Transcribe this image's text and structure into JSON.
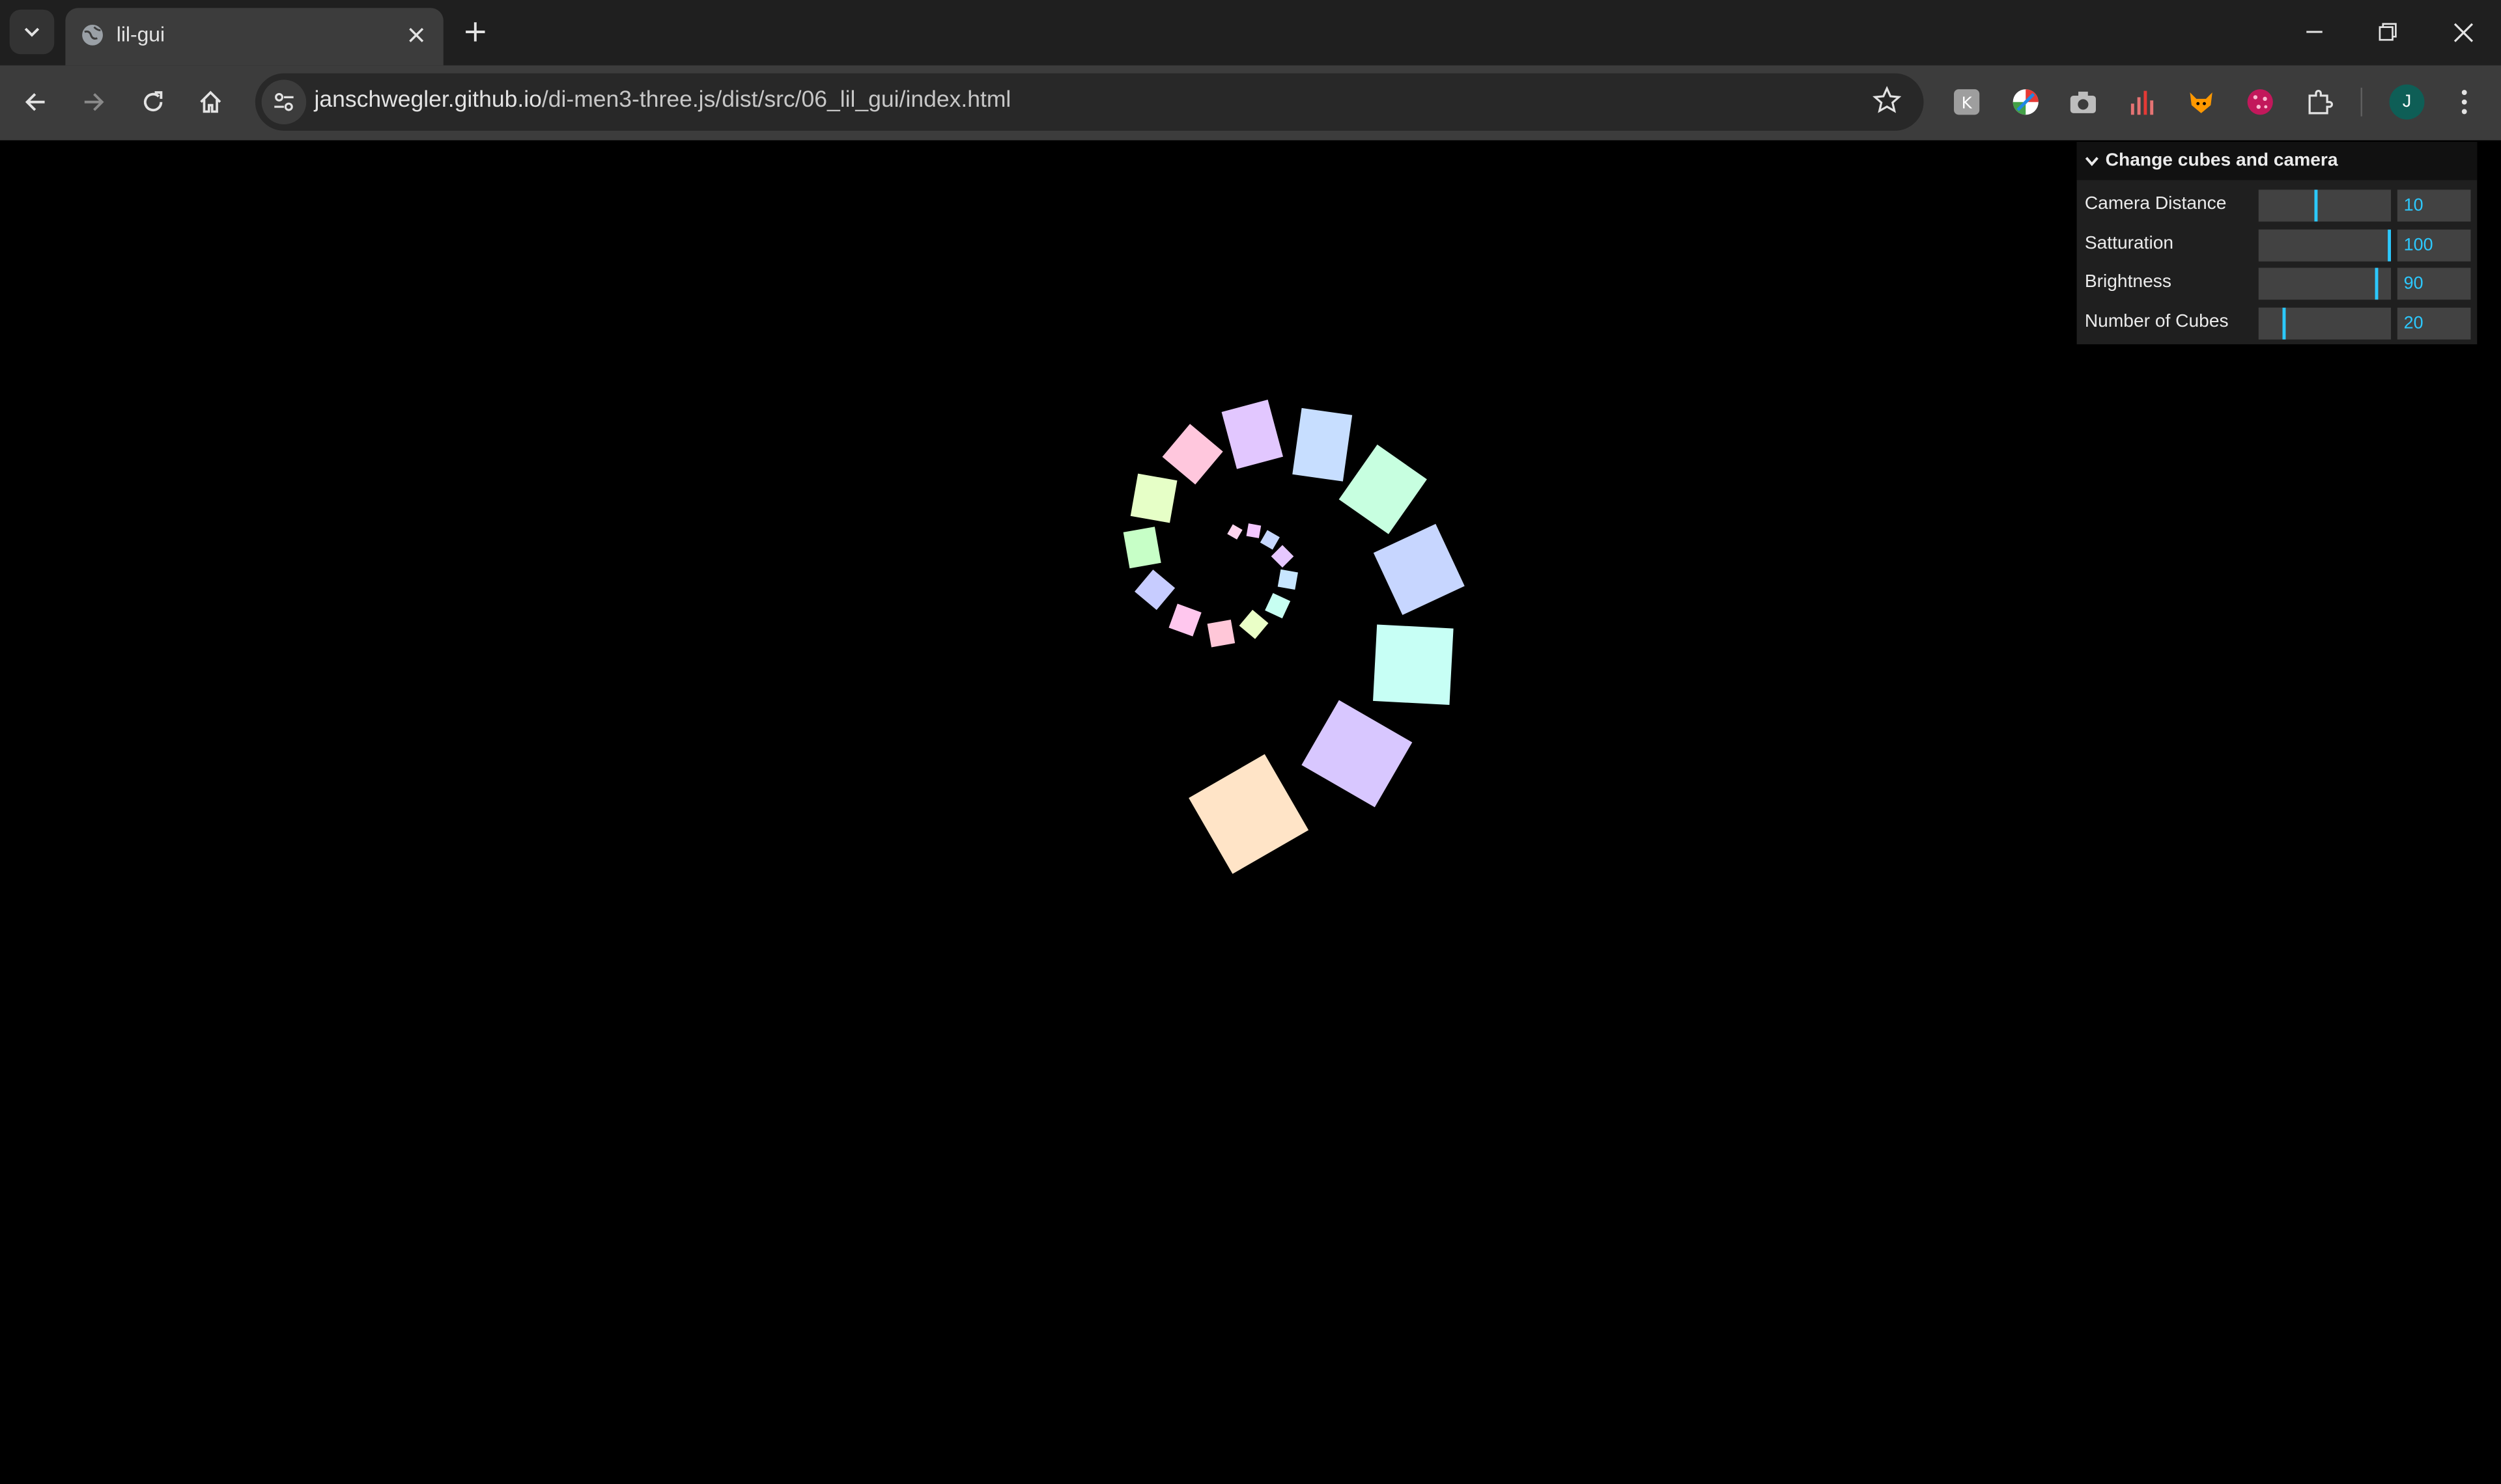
{
  "tab": {
    "title": "lil-gui"
  },
  "omnibox": {
    "host": "janschwegler.github.io",
    "path": "/di-men3-three.js/dist/src/06_lil_gui/index.html"
  },
  "profile": {
    "initial": "J"
  },
  "icons": {
    "tab_search": "chevron-down-icon",
    "favicon": "globe-icon",
    "close": "close-icon",
    "new_tab": "plus-icon",
    "minimize": "minimize-icon",
    "restore": "restore-icon",
    "window_close": "close-icon",
    "back": "arrow-left-icon",
    "forward": "arrow-right-icon",
    "reload": "reload-icon",
    "home": "home-icon",
    "site_info": "tune-icon",
    "bookmark": "star-icon",
    "extensions": "puzzle-icon",
    "menu": "kebab-icon"
  },
  "gui": {
    "title": "Change cubes and camera",
    "controllers": [
      {
        "label": "Camera Distance",
        "value": "10",
        "fraction": 0.45
      },
      {
        "label": "Satturation",
        "value": "100",
        "fraction": 1.0
      },
      {
        "label": "Brightness",
        "value": "90",
        "fraction": 0.9
      },
      {
        "label": "Number of Cubes",
        "value": "20",
        "fraction": 0.2
      }
    ]
  },
  "colors": {
    "accent": "#2cc9ff",
    "gui_bg": "#1f1f1f",
    "slider_bg": "#424242"
  }
}
